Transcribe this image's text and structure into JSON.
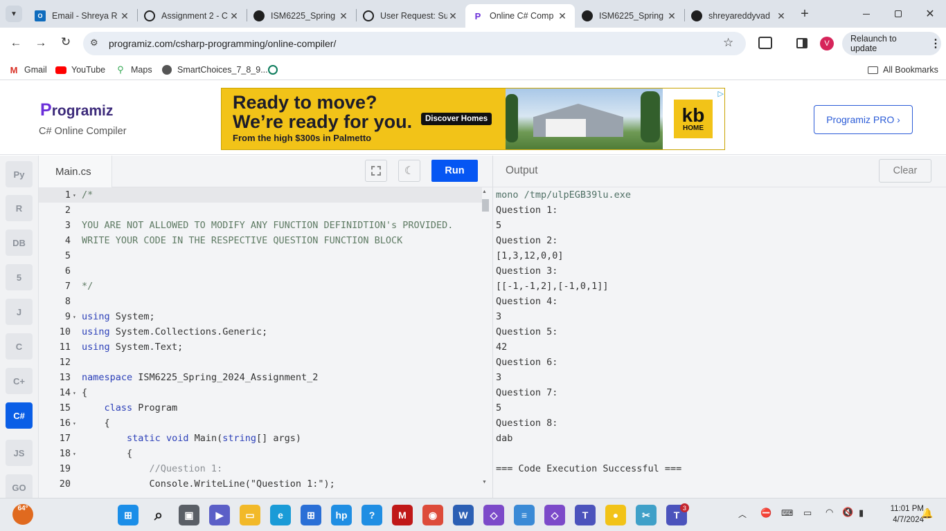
{
  "browser": {
    "tabs": [
      {
        "title": "Email - Shreya R",
        "icon": "outlook-icon",
        "active": false
      },
      {
        "title": "Assignment 2 - C",
        "icon": "openai-icon",
        "active": false
      },
      {
        "title": "ISM6225_Spring",
        "icon": "github-icon",
        "active": false
      },
      {
        "title": "User Request: Su",
        "icon": "openai-icon",
        "active": false
      },
      {
        "title": "Online C# Comp",
        "icon": "programiz-icon",
        "active": true
      },
      {
        "title": "ISM6225_Spring",
        "icon": "github-icon",
        "active": false
      },
      {
        "title": "shreyareddyvad",
        "icon": "github-icon",
        "active": false
      }
    ],
    "new_tab": "+",
    "url": "programiz.com/csharp-programming/online-compiler/",
    "profile_initial": "V",
    "relaunch_label": "Relaunch to update",
    "bookmarks": [
      {
        "label": "Gmail",
        "icon": "gmail-icon"
      },
      {
        "label": "YouTube",
        "icon": "youtube-icon"
      },
      {
        "label": "Maps",
        "icon": "maps-icon"
      },
      {
        "label": "SmartChoices_7_8_9...",
        "icon": "globe-icon"
      },
      {
        "label": "",
        "icon": "openai-icon"
      }
    ],
    "all_bookmarks": "All Bookmarks"
  },
  "site": {
    "logo_text": "rogramiz",
    "logo_letter": "P",
    "subtitle": "C# Online Compiler",
    "pro_button": "Programiz PRO ›"
  },
  "ad": {
    "headline1": "Ready to move?",
    "headline2": "We’re ready for you.",
    "subline": "From the high $300s in Palmetto",
    "cta": "Discover Homes",
    "brand_top": "kb",
    "brand_bottom": "HOME",
    "accent": "#f2c318"
  },
  "rail": {
    "items": [
      {
        "name": "python-icon",
        "label": "Py"
      },
      {
        "name": "r-icon",
        "label": "R"
      },
      {
        "name": "sql-icon",
        "label": "DB"
      },
      {
        "name": "html5-icon",
        "label": "5"
      },
      {
        "name": "java-icon",
        "label": "J"
      },
      {
        "name": "c-icon",
        "label": "C"
      },
      {
        "name": "cpp-icon",
        "label": "C+"
      },
      {
        "name": "csharp-icon",
        "label": "C#"
      },
      {
        "name": "javascript-icon",
        "label": "JS"
      },
      {
        "name": "go-icon",
        "label": "GO"
      }
    ],
    "active_index": 7
  },
  "editor": {
    "filename": "Main.cs",
    "run_label": "Run",
    "run_color": "#0556f3",
    "lines": [
      {
        "n": "1",
        "fold": true,
        "text": "/*",
        "kind": "comment"
      },
      {
        "n": "2",
        "fold": false,
        "text": "",
        "kind": "comment"
      },
      {
        "n": "3",
        "fold": false,
        "text": "YOU ARE NOT ALLOWED TO MODIFY ANY FUNCTION DEFINIDTION's PROVIDED.",
        "kind": "comment"
      },
      {
        "n": "4",
        "fold": false,
        "text": "WRITE YOUR CODE IN THE RESPECTIVE QUESTION FUNCTION BLOCK",
        "kind": "comment"
      },
      {
        "n": "5",
        "fold": false,
        "text": "",
        "kind": "comment"
      },
      {
        "n": "6",
        "fold": false,
        "text": "",
        "kind": "comment"
      },
      {
        "n": "7",
        "fold": false,
        "text": "*/",
        "kind": "comment"
      },
      {
        "n": "8",
        "fold": false,
        "text": "",
        "kind": "plain"
      },
      {
        "n": "9",
        "fold": true,
        "text": "using System;",
        "kind": "using"
      },
      {
        "n": "10",
        "fold": false,
        "text": "using System.Collections.Generic;",
        "kind": "using"
      },
      {
        "n": "11",
        "fold": false,
        "text": "using System.Text;",
        "kind": "using"
      },
      {
        "n": "12",
        "fold": false,
        "text": "",
        "kind": "plain"
      },
      {
        "n": "13",
        "fold": false,
        "text": "namespace ISM6225_Spring_2024_Assignment_2",
        "kind": "namespace"
      },
      {
        "n": "14",
        "fold": true,
        "text": "{",
        "kind": "plain"
      },
      {
        "n": "15",
        "fold": false,
        "text": "    class Program",
        "kind": "class"
      },
      {
        "n": "16",
        "fold": true,
        "text": "    {",
        "kind": "plain"
      },
      {
        "n": "17",
        "fold": false,
        "text": "        static void Main(string[] args)",
        "kind": "method"
      },
      {
        "n": "18",
        "fold": true,
        "text": "        {",
        "kind": "plain"
      },
      {
        "n": "19",
        "fold": false,
        "text": "            //Question 1:",
        "kind": "linecomment"
      },
      {
        "n": "20",
        "fold": false,
        "text": "            Console.WriteLine(\"Question 1:\");",
        "kind": "call"
      }
    ]
  },
  "output": {
    "title": "Output",
    "clear_label": "Clear",
    "lines": [
      "mono /tmp/ulpEGB39lu.exe",
      "Question 1:",
      "5",
      "Question 2:",
      "[1,3,12,0,0]",
      "Question 3:",
      "[[-1,-1,2],[-1,0,1]]",
      "Question 4:",
      "3",
      "Question 5:",
      "42",
      "Question 6:",
      "3",
      "Question 7:",
      "5",
      "Question 8:",
      "dab",
      "",
      "=== Code Execution Successful ==="
    ]
  },
  "taskbar": {
    "weather": "64°",
    "time": "11:01 PM",
    "date": "4/7/2024",
    "apps": [
      "windows-start-icon",
      "search-icon",
      "task-view-icon",
      "teams-meet-icon",
      "file-explorer-icon",
      "edge-icon",
      "store-icon",
      "hp-icon",
      "help-icon",
      "mcafee-icon",
      "chrome-icon",
      "word-icon",
      "visual-studio-icon",
      "notepad-icon",
      "vs-code-icon",
      "teams-icon",
      "duck-icon",
      "snip-icon",
      "teams-work-icon"
    ],
    "teams_badge": "3"
  }
}
